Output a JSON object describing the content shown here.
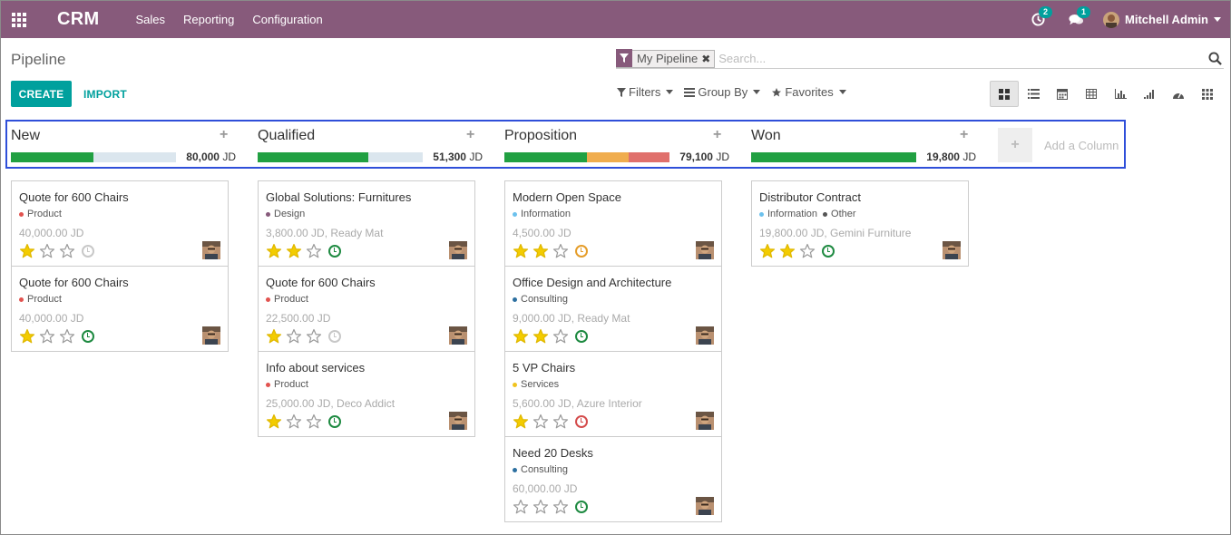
{
  "navbar": {
    "brand": "CRM",
    "menu": [
      "Sales",
      "Reporting",
      "Configuration"
    ],
    "activity_count": "2",
    "message_count": "1",
    "user_name": "Mitchell Admin",
    "color": "#875a7b"
  },
  "control": {
    "breadcrumb": "Pipeline",
    "create_label": "CREATE",
    "import_label": "IMPORT",
    "facet_label": "My Pipeline",
    "search_placeholder": "Search...",
    "filters_label": "Filters",
    "groupby_label": "Group By",
    "favorites_label": "Favorites",
    "views": [
      "kanban-icon",
      "list-icon",
      "calendar-icon",
      "pivot-icon",
      "graph-icon",
      "cohort-icon",
      "dashboard-icon",
      "grid-icon"
    ],
    "accent": "#00a09d"
  },
  "columns": [
    {
      "title": "New",
      "total": "80,000",
      "currency": "JD",
      "progress": [
        {
          "color": "#21a042",
          "pct": 50
        }
      ],
      "cards": [
        {
          "title": "Quote for 600 Chairs",
          "tags": [
            {
              "name": "Product",
              "color": "#e2534f"
            }
          ],
          "amount": "40,000.00 JD",
          "stars": 1,
          "activity": "none"
        },
        {
          "title": "Quote for 600 Chairs",
          "tags": [
            {
              "name": "Product",
              "color": "#e2534f"
            }
          ],
          "amount": "40,000.00 JD",
          "stars": 1,
          "activity": "planned"
        }
      ]
    },
    {
      "title": "Qualified",
      "total": "51,300",
      "currency": "JD",
      "progress": [
        {
          "color": "#21a042",
          "pct": 67
        }
      ],
      "cards": [
        {
          "title": "Global Solutions: Furnitures",
          "tags": [
            {
              "name": "Design",
              "color": "#875a7b"
            }
          ],
          "amount": "3,800.00 JD, Ready Mat",
          "stars": 2,
          "activity": "planned"
        },
        {
          "title": "Quote for 600 Chairs",
          "tags": [
            {
              "name": "Product",
              "color": "#e2534f"
            }
          ],
          "amount": "22,500.00 JD",
          "stars": 1,
          "activity": "none"
        },
        {
          "title": "Info about services",
          "tags": [
            {
              "name": "Product",
              "color": "#e2534f"
            }
          ],
          "amount": "25,000.00 JD, Deco Addict",
          "stars": 1,
          "activity": "planned"
        }
      ]
    },
    {
      "title": "Proposition",
      "total": "79,100",
      "currency": "JD",
      "progress": [
        {
          "color": "#21a042",
          "pct": 50
        },
        {
          "color": "#f0ad4e",
          "pct": 25
        },
        {
          "color": "#e0706c",
          "pct": 25
        }
      ],
      "cards": [
        {
          "title": "Modern Open Space",
          "tags": [
            {
              "name": "Information",
              "color": "#6cc1ed"
            }
          ],
          "amount": "4,500.00 JD",
          "stars": 2,
          "activity": "today"
        },
        {
          "title": "Office Design and Architecture",
          "tags": [
            {
              "name": "Consulting",
              "color": "#2c6fa0"
            }
          ],
          "amount": "9,000.00 JD, Ready Mat",
          "stars": 2,
          "activity": "planned"
        },
        {
          "title": "5 VP Chairs",
          "tags": [
            {
              "name": "Services",
              "color": "#f0c31e"
            }
          ],
          "amount": "5,600.00 JD, Azure Interior",
          "stars": 1,
          "activity": "overdue"
        },
        {
          "title": "Need 20 Desks",
          "tags": [
            {
              "name": "Consulting",
              "color": "#2c6fa0"
            }
          ],
          "amount": "60,000.00 JD",
          "stars": 0,
          "activity": "planned"
        }
      ]
    },
    {
      "title": "Won",
      "total": "19,800",
      "currency": "JD",
      "progress": [
        {
          "color": "#21a042",
          "pct": 100
        }
      ],
      "cards": [
        {
          "title": "Distributor Contract",
          "tags": [
            {
              "name": "Information",
              "color": "#6cc1ed"
            },
            {
              "name": "Other",
              "color": "#555555"
            }
          ],
          "amount": "19,800.00 JD, Gemini Furniture",
          "stars": 2,
          "activity": "planned"
        }
      ]
    }
  ],
  "add_column_label": "Add a Column"
}
